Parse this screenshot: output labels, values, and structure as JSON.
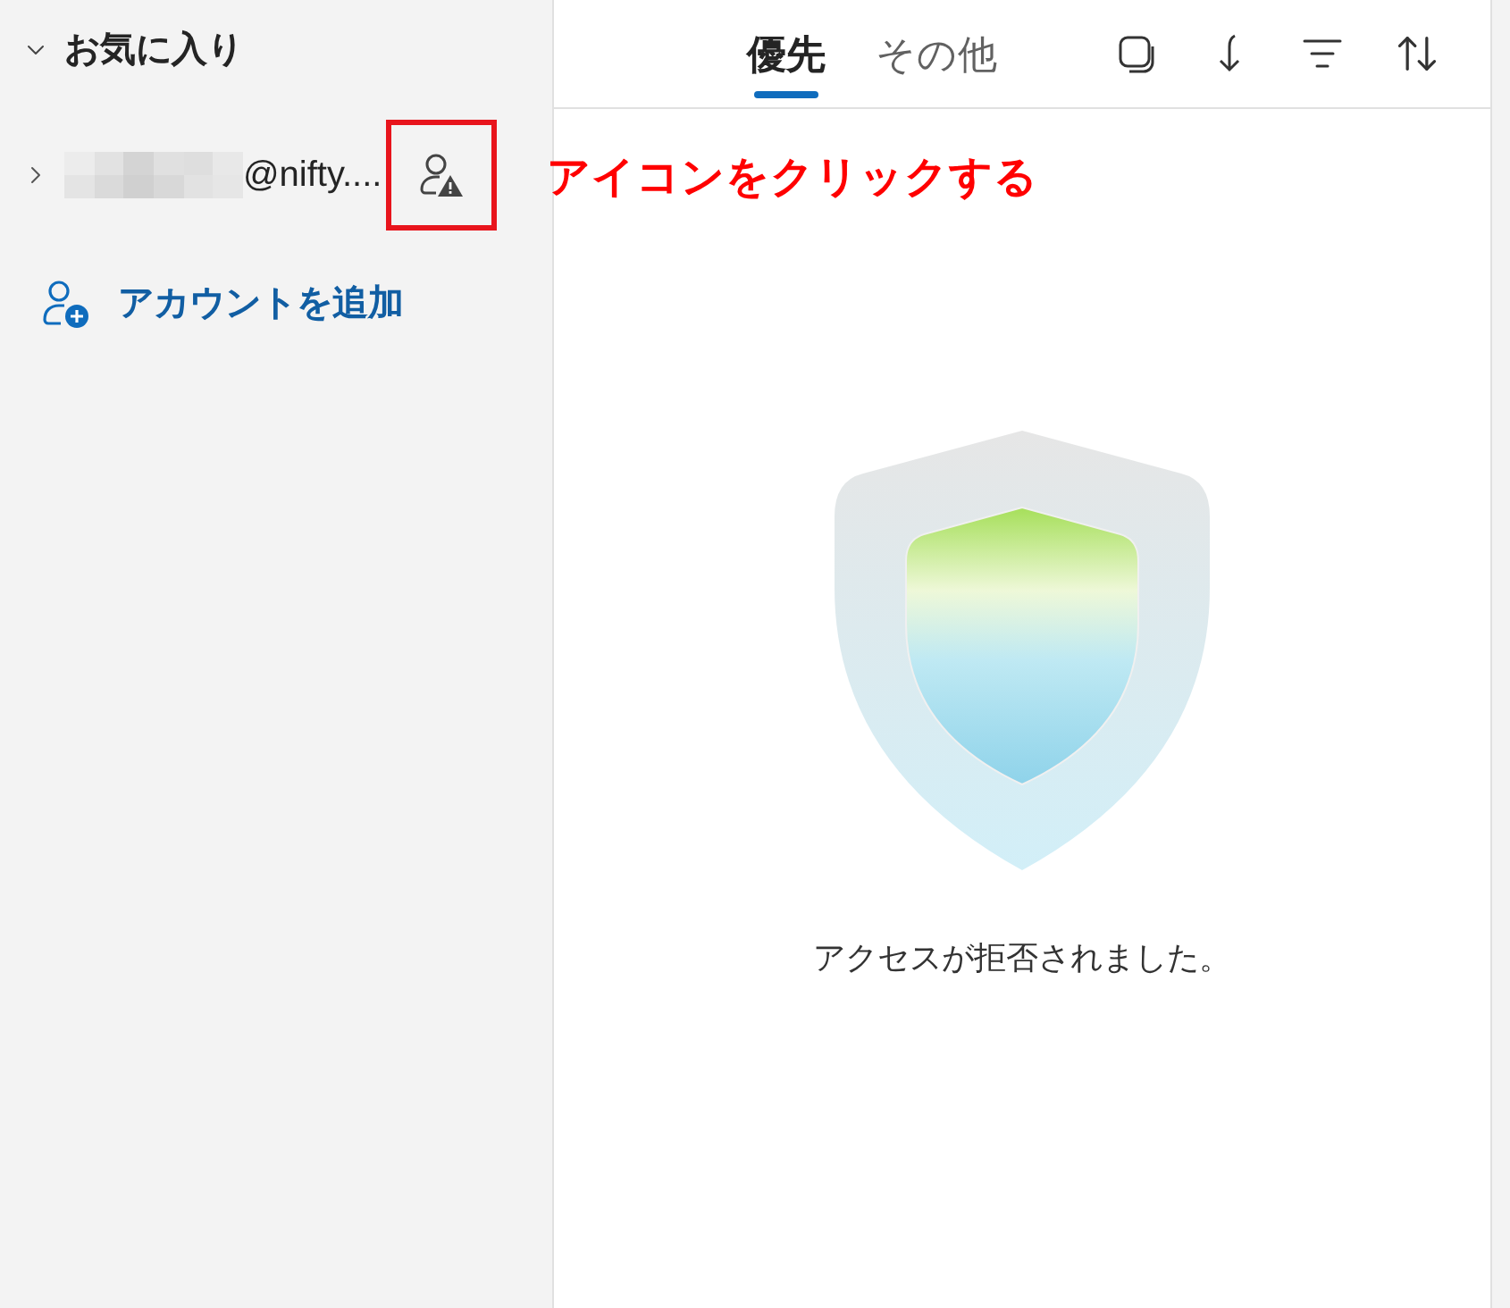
{
  "sidebar": {
    "favorites": {
      "label": "お気に入り",
      "expanded": true
    },
    "account": {
      "email": "@nifty....",
      "expanded": false
    },
    "add_account": {
      "label": "アカウントを追加"
    }
  },
  "annotation": {
    "text": "アイコンをクリックする"
  },
  "tabs": [
    {
      "label": "優先",
      "selected": true
    },
    {
      "label": "その他",
      "selected": false
    }
  ],
  "message": "アクセスが拒否されました。"
}
